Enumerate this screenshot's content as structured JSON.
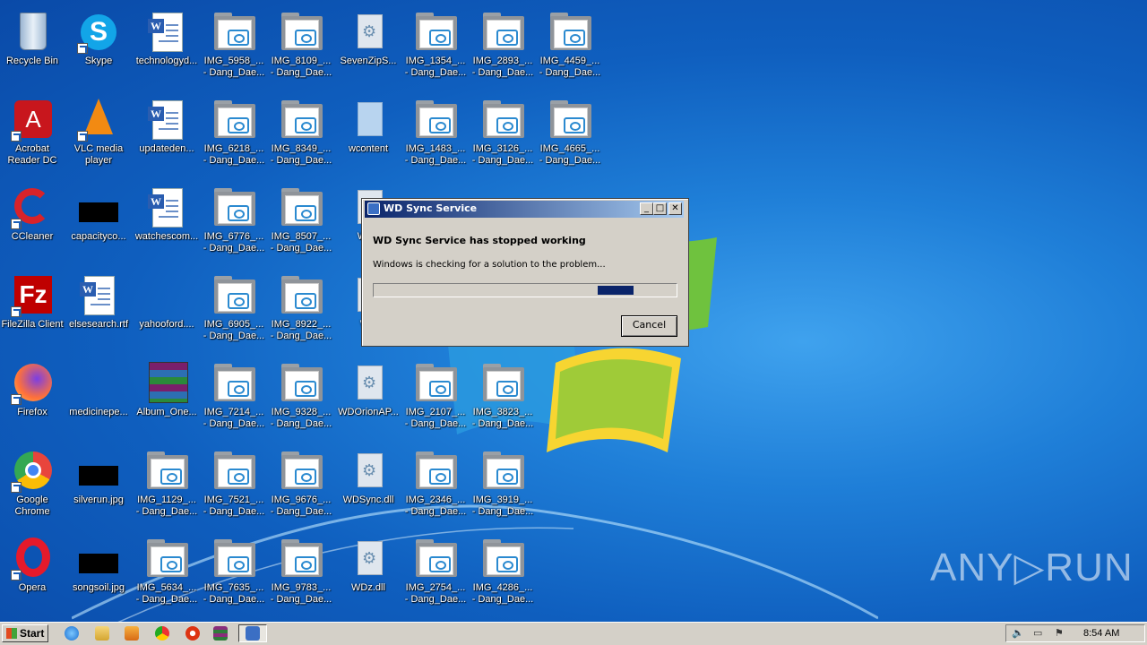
{
  "desktop": {
    "icons": [
      {
        "label": "Recycle Bin",
        "type": "recycle"
      },
      {
        "label": "Skype",
        "type": "skype"
      },
      {
        "label": "technologyd...",
        "type": "word"
      },
      {
        "label": "IMG_5958_...\n- Dang_Dae...",
        "type": "folder"
      },
      {
        "label": "IMG_8109_...\n- Dang_Dae...",
        "type": "folder"
      },
      {
        "label": "SevenZipS...",
        "type": "gear"
      },
      {
        "label": "IMG_1354_...\n- Dang_Dae...",
        "type": "folder"
      },
      {
        "label": "IMG_2893_...\n- Dang_Dae...",
        "type": "folder"
      },
      {
        "label": "IMG_4459_...\n- Dang_Dae...",
        "type": "folder"
      },
      {
        "label": "Acrobat\nReader DC",
        "type": "acrobat"
      },
      {
        "label": "VLC media\nplayer",
        "type": "vlc"
      },
      {
        "label": "updateden...",
        "type": "word"
      },
      {
        "label": "IMG_6218_...\n- Dang_Dae...",
        "type": "folder"
      },
      {
        "label": "IMG_8349_...\n- Dang_Dae...",
        "type": "folder"
      },
      {
        "label": "wcontent",
        "type": "blank"
      },
      {
        "label": "IMG_1483_...\n- Dang_Dae...",
        "type": "folder"
      },
      {
        "label": "IMG_3126_...\n- Dang_Dae...",
        "type": "folder"
      },
      {
        "label": "IMG_4665_...\n- Dang_Dae...",
        "type": "folder"
      },
      {
        "label": "CCleaner",
        "type": "ccleaner"
      },
      {
        "label": "capacityco...",
        "type": "blackbox"
      },
      {
        "label": "watchescom...",
        "type": "word"
      },
      {
        "label": "IMG_6776_...\n- Dang_Dae...",
        "type": "folder"
      },
      {
        "label": "IMG_8507_...\n- Dang_Dae...",
        "type": "folder"
      },
      {
        "label": "WDL",
        "type": "gear"
      },
      {
        "label": "FileZilla Client",
        "type": "filezilla"
      },
      {
        "label": "elsesearch.rtf",
        "type": "word"
      },
      {
        "label": "yahooford....",
        "type": "blank2"
      },
      {
        "label": "IMG_6905_...\n- Dang_Dae...",
        "type": "folder"
      },
      {
        "label": "IMG_8922_...\n- Dang_Dae...",
        "type": "folder"
      },
      {
        "label": "WD",
        "type": "gear"
      },
      {
        "label": "Firefox",
        "type": "firefox"
      },
      {
        "label": "medicinepe...",
        "type": "blank2"
      },
      {
        "label": "Album_One...",
        "type": "winrar"
      },
      {
        "label": "IMG_7214_...\n- Dang_Dae...",
        "type": "folder"
      },
      {
        "label": "IMG_9328_...\n- Dang_Dae...",
        "type": "folder"
      },
      {
        "label": "WDOrionAP...",
        "type": "gear"
      },
      {
        "label": "IMG_2107_...\n- Dang_Dae...",
        "type": "folder"
      },
      {
        "label": "IMG_3823_...\n- Dang_Dae...",
        "type": "folder"
      },
      {
        "label": "Google\nChrome",
        "type": "chrome"
      },
      {
        "label": "silverun.jpg",
        "type": "blackbox"
      },
      {
        "label": "IMG_1129_...\n- Dang_Dae...",
        "type": "folder"
      },
      {
        "label": "IMG_7521_...\n- Dang_Dae...",
        "type": "folder"
      },
      {
        "label": "IMG_9676_...\n- Dang_Dae...",
        "type": "folder"
      },
      {
        "label": "WDSync.dll",
        "type": "gear"
      },
      {
        "label": "IMG_2346_...\n- Dang_Dae...",
        "type": "folder"
      },
      {
        "label": "IMG_3919_...\n- Dang_Dae...",
        "type": "folder"
      },
      {
        "label": "Opera",
        "type": "opera"
      },
      {
        "label": "songsoil.jpg",
        "type": "blackbox"
      },
      {
        "label": "IMG_5634_...\n- Dang_Dae...",
        "type": "folder"
      },
      {
        "label": "IMG_7635_...\n- Dang_Dae...",
        "type": "folder"
      },
      {
        "label": "IMG_9783_...\n- Dang_Dae...",
        "type": "folder"
      },
      {
        "label": "WDz.dll",
        "type": "gear"
      },
      {
        "label": "IMG_2754_...\n- Dang_Dae...",
        "type": "folder"
      },
      {
        "label": "IMG_4286_...\n- Dang_Dae...",
        "type": "folder"
      }
    ]
  },
  "dialog": {
    "title": "WD Sync Service",
    "heading": "WD Sync Service has stopped working",
    "message": "Windows is checking for a solution to the problem...",
    "cancel_label": "Cancel",
    "minimize_glyph": "_",
    "maximize_glyph": "□",
    "close_glyph": "✕"
  },
  "taskbar": {
    "start_label": "Start",
    "clock": "8:54 AM",
    "pinned": [
      "ie-icon",
      "explorer-icon",
      "media-player-icon",
      "chrome-icon",
      "opera-icon",
      "winrar-icon"
    ]
  },
  "watermark": "ANY▷RUN"
}
